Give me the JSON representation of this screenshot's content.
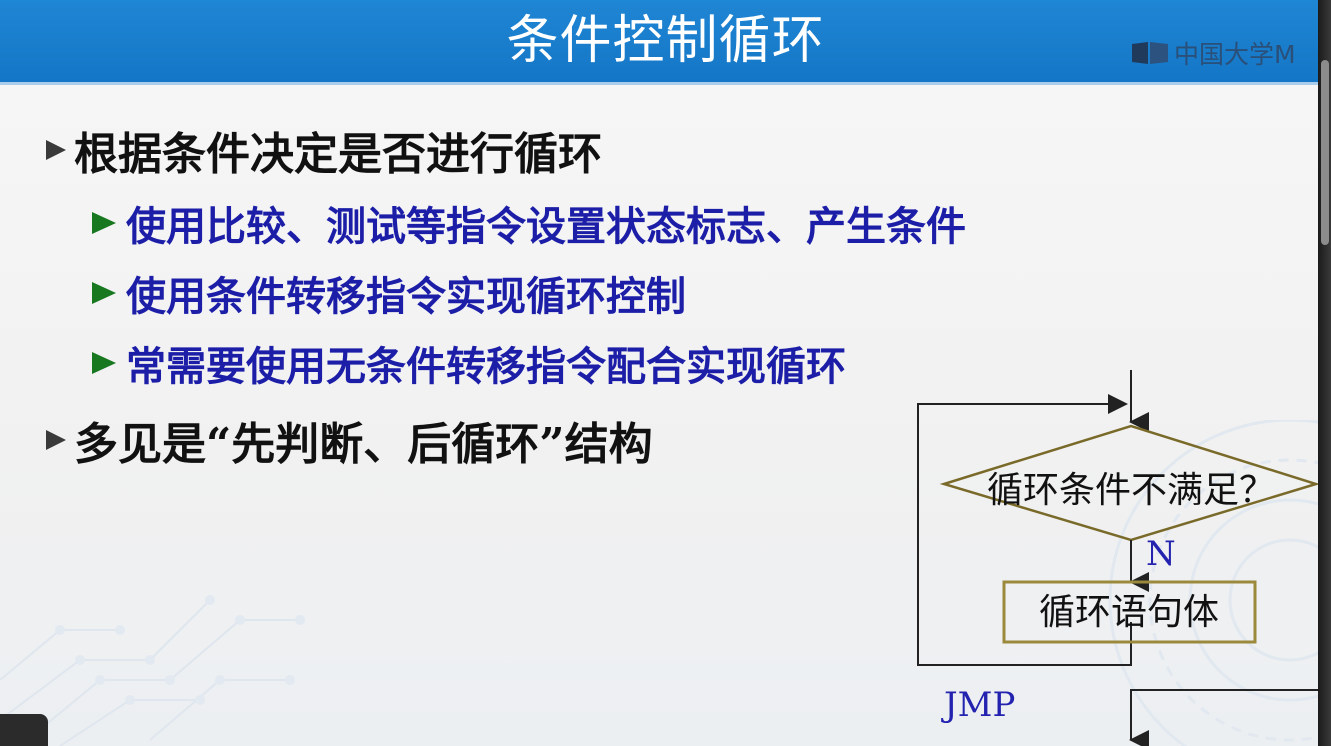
{
  "slide": {
    "title": "条件控制循环",
    "logo_text": "中国大学M",
    "bullets": [
      {
        "level": 1,
        "text": "根据条件决定是否进行循环"
      },
      {
        "level": 2,
        "text": "使用比较、测试等指令设置状态标志、产生条件"
      },
      {
        "level": 2,
        "text": "使用条件转移指令实现循环控制"
      },
      {
        "level": 2,
        "text": "常需要使用无条件转移指令配合实现循环"
      },
      {
        "level": 1,
        "text": "多见是“先判断、后循环”结构"
      }
    ]
  },
  "flowchart": {
    "decision_label": "循环条件不满足？",
    "branch_no_label": "N",
    "body_label": "循环语句体",
    "jump_label": "JMP"
  },
  "colors": {
    "title_bar": "#1a7cca",
    "level1_text": "#111111",
    "level2_text": "#1c1ea8",
    "level2_marker": "#17781f",
    "diamond_border": "#7a6a2a",
    "box_border": "#9c8a3c",
    "label_blue": "#2323b0"
  },
  "icons": [
    "mooc-logo-icon",
    "bullet-arrow-icon",
    "bullet-triangle-icon"
  ]
}
